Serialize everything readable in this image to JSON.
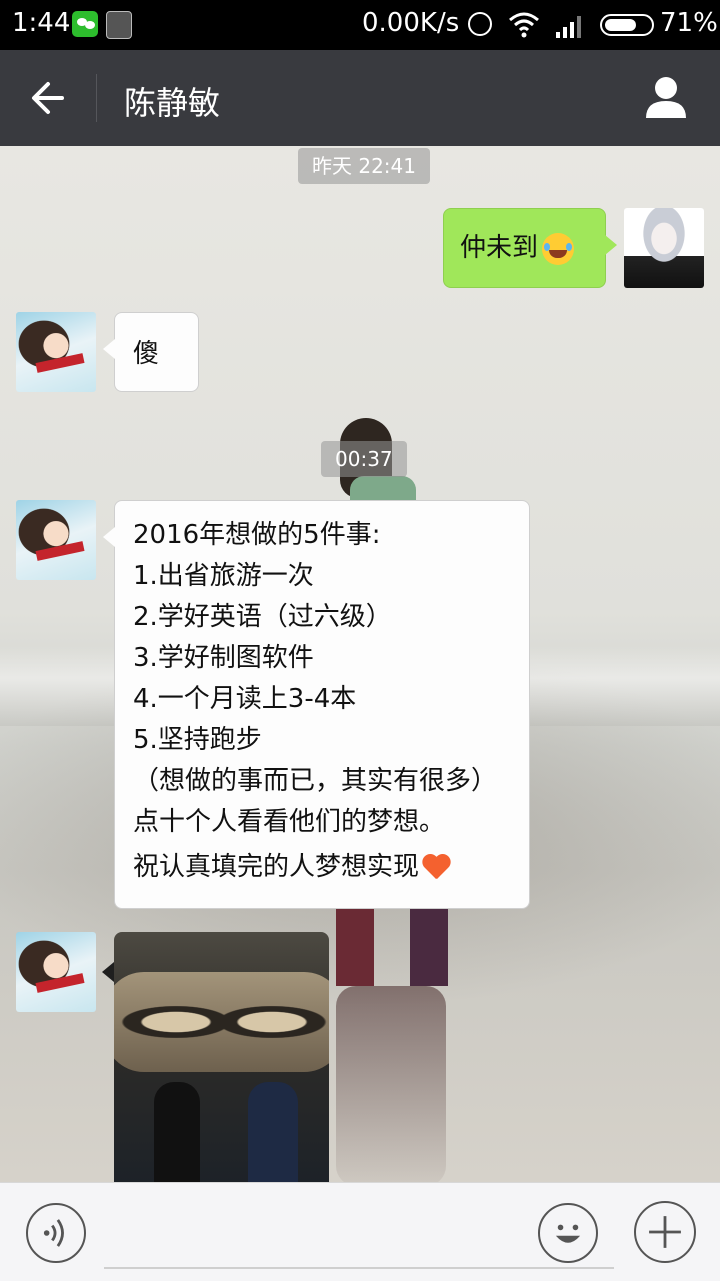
{
  "status_bar": {
    "time": "1:44",
    "net_speed": "0.00K/s",
    "battery_pct": "71%",
    "battery_level": 0.71,
    "icons": [
      "wechat-icon",
      "app-icon",
      "alarm-icon",
      "wifi-icon",
      "signal-icon",
      "battery-icon"
    ]
  },
  "header": {
    "title": "陈静敏",
    "back_icon": "arrow-left-icon",
    "profile_icon": "person-icon",
    "background": "#393a3f"
  },
  "messages": {
    "ts1": "昨天 22:41",
    "out1": "仲未到",
    "out1_emoji": "tears-of-joy-emoji",
    "in1": "傻",
    "ts2": "00:37",
    "in2_lines": [
      "2016年想做的5件事:",
      "1.出省旅游一次",
      "2.学好英语（过六级）",
      "3.学好制图软件",
      "4.一个月读上3-4本",
      "5.坚持跑步",
      "（想做的事而已，其实有很多）",
      "点十个人看看他们的梦想。",
      "祝认真填完的人梦想实现"
    ],
    "in2_emoji": "heart-emoji",
    "in3_type": "image"
  },
  "colors": {
    "outgoing_bubble": "#a0e75a",
    "incoming_bubble": "#fdfdfd",
    "heart": "#f4612f"
  },
  "input_bar": {
    "voice_icon": "voice-icon",
    "emoji_icon": "smiley-icon",
    "plus_icon": "plus-icon",
    "input_value": ""
  }
}
